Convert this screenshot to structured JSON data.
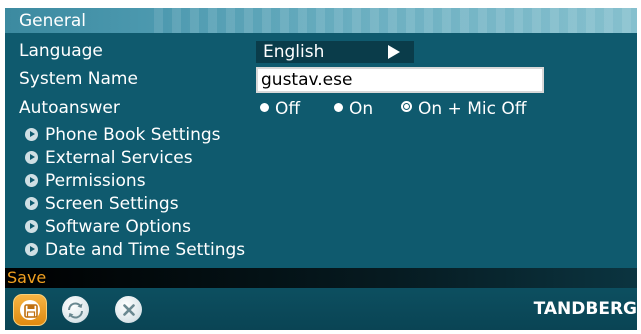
{
  "header": {
    "title": "General"
  },
  "settings": {
    "language": {
      "label": "Language",
      "value": "English"
    },
    "system_name": {
      "label": "System Name",
      "value": "gustav.ese"
    },
    "autoanswer": {
      "label": "Autoanswer",
      "options": [
        "Off",
        "On",
        "On + Mic Off"
      ],
      "selected": "On + Mic Off"
    }
  },
  "menu": {
    "items": [
      {
        "label": "Phone Book Settings"
      },
      {
        "label": "External Services"
      },
      {
        "label": "Permissions"
      },
      {
        "label": "Screen Settings"
      },
      {
        "label": "Software Options"
      },
      {
        "label": "Date and Time Settings"
      }
    ]
  },
  "status": {
    "text": "Save"
  },
  "toolbar": {
    "buttons": [
      {
        "name": "save",
        "icon": "floppy-disk-icon"
      },
      {
        "name": "refresh",
        "icon": "refresh-icon"
      },
      {
        "name": "cancel",
        "icon": "close-icon"
      }
    ]
  },
  "brand": {
    "logo": "TANDBERG"
  },
  "colors": {
    "panel": "#0f5a6e",
    "title_bar": "#4b98ae",
    "status_text": "#f0a020",
    "save_button": "#f0a030"
  }
}
